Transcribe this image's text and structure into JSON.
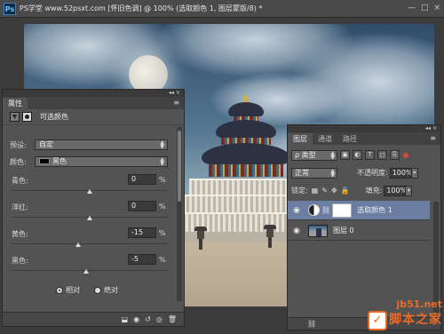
{
  "app": {
    "logo_text": "Ps",
    "document_title": "PS学堂 www.52psxt.com [怀旧色调] @ 100% (选取颜色 1, 图层蒙版/8) *",
    "window_controls": [
      "—",
      "□",
      "×"
    ]
  },
  "properties_panel": {
    "tab_label": "属性",
    "header_title": "可选颜色",
    "preset": {
      "label": "预设:",
      "value": "自定"
    },
    "colors": {
      "label": "颜色:",
      "value": "黑色",
      "swatch_color": "#000000"
    },
    "sliders": [
      {
        "label": "青色:",
        "value": "0",
        "unit": "%",
        "level": 0
      },
      {
        "label": "洋红:",
        "value": "0",
        "unit": "%",
        "level": 0
      },
      {
        "label": "黄色:",
        "value": "-15",
        "unit": "%",
        "level": -15
      },
      {
        "label": "黑色:",
        "value": "-5",
        "unit": "%",
        "level": -5
      }
    ],
    "method": {
      "options": [
        {
          "label": "相对",
          "selected": true
        },
        {
          "label": "绝对",
          "selected": false
        }
      ]
    },
    "footer_icons": [
      "clip-to-layer-icon",
      "view-previous-icon",
      "reset-icon",
      "visibility-icon",
      "trash-icon"
    ]
  },
  "layers_panel": {
    "tabs": [
      "图层",
      "通道",
      "路径"
    ],
    "active_tab": 0,
    "filter": {
      "label": "ρ 类型"
    },
    "blend_mode": "正常",
    "opacity": {
      "label": "不透明度:",
      "value": "100%"
    },
    "lock": {
      "label": "锁定:"
    },
    "fill": {
      "label": "填充:",
      "value": "100%"
    },
    "layers": [
      {
        "name": "选取颜色 1",
        "selected": true,
        "type": "adjustment"
      },
      {
        "name": "图层 0",
        "selected": false,
        "type": "image"
      }
    ],
    "footer_icons": [
      "link-icon",
      "fx-icon",
      "mask-icon",
      "adjustment-icon",
      "folder-icon",
      "new-layer-icon",
      "trash-icon"
    ]
  },
  "watermark": {
    "url": "jb51.net",
    "name": "脚本之家",
    "accent_color": "#e86b2a"
  }
}
